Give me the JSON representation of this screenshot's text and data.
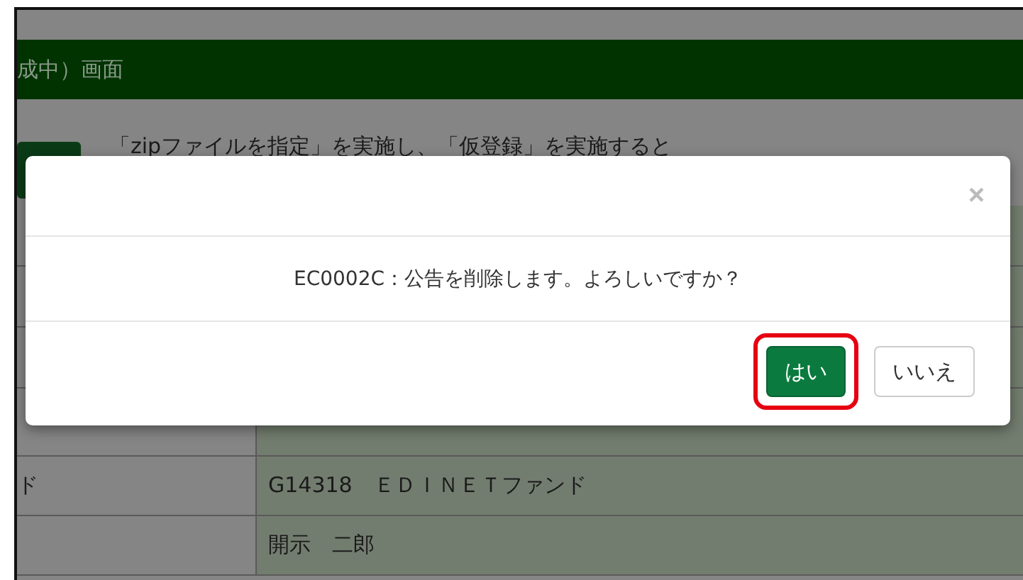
{
  "page": {
    "header_title": "成中）画面",
    "notice": "「zipファイルを指定」を実施し、「仮登録」を実施すると",
    "table_rows": [
      {
        "value": "G14318　ＥＤＩＮＥＴファンド",
        "label": "ド"
      },
      {
        "value": "開示　二郎"
      }
    ]
  },
  "dialog": {
    "close": "×",
    "message": "EC0002C：公告を削除します。よろしいですか？",
    "buttons": [
      {
        "label": "はい",
        "kind": "primary",
        "highlighted": true
      },
      {
        "label": "いいえ",
        "kind": "default",
        "highlighted": false
      }
    ]
  }
}
